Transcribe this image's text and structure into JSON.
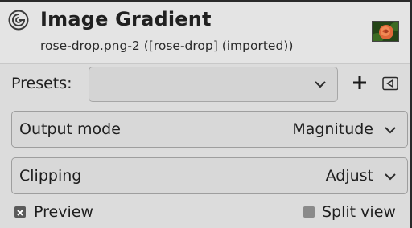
{
  "header": {
    "title": "Image Gradient",
    "subtitle": "rose-drop.png-2 ([rose-drop] (imported))",
    "icon": "gegl-spiral-icon",
    "thumbnail": "rose-thumbnail"
  },
  "presets": {
    "label": "Presets:",
    "value": "",
    "add_icon": "plus-icon",
    "menu_icon": "menu-triangle-icon"
  },
  "output_mode": {
    "label": "Output mode",
    "value": "Magnitude"
  },
  "clipping": {
    "label": "Clipping",
    "value": "Adjust"
  },
  "footer": {
    "preview_label": "Preview",
    "preview_checked": true,
    "split_view_label": "Split view",
    "split_view_checked": false
  }
}
